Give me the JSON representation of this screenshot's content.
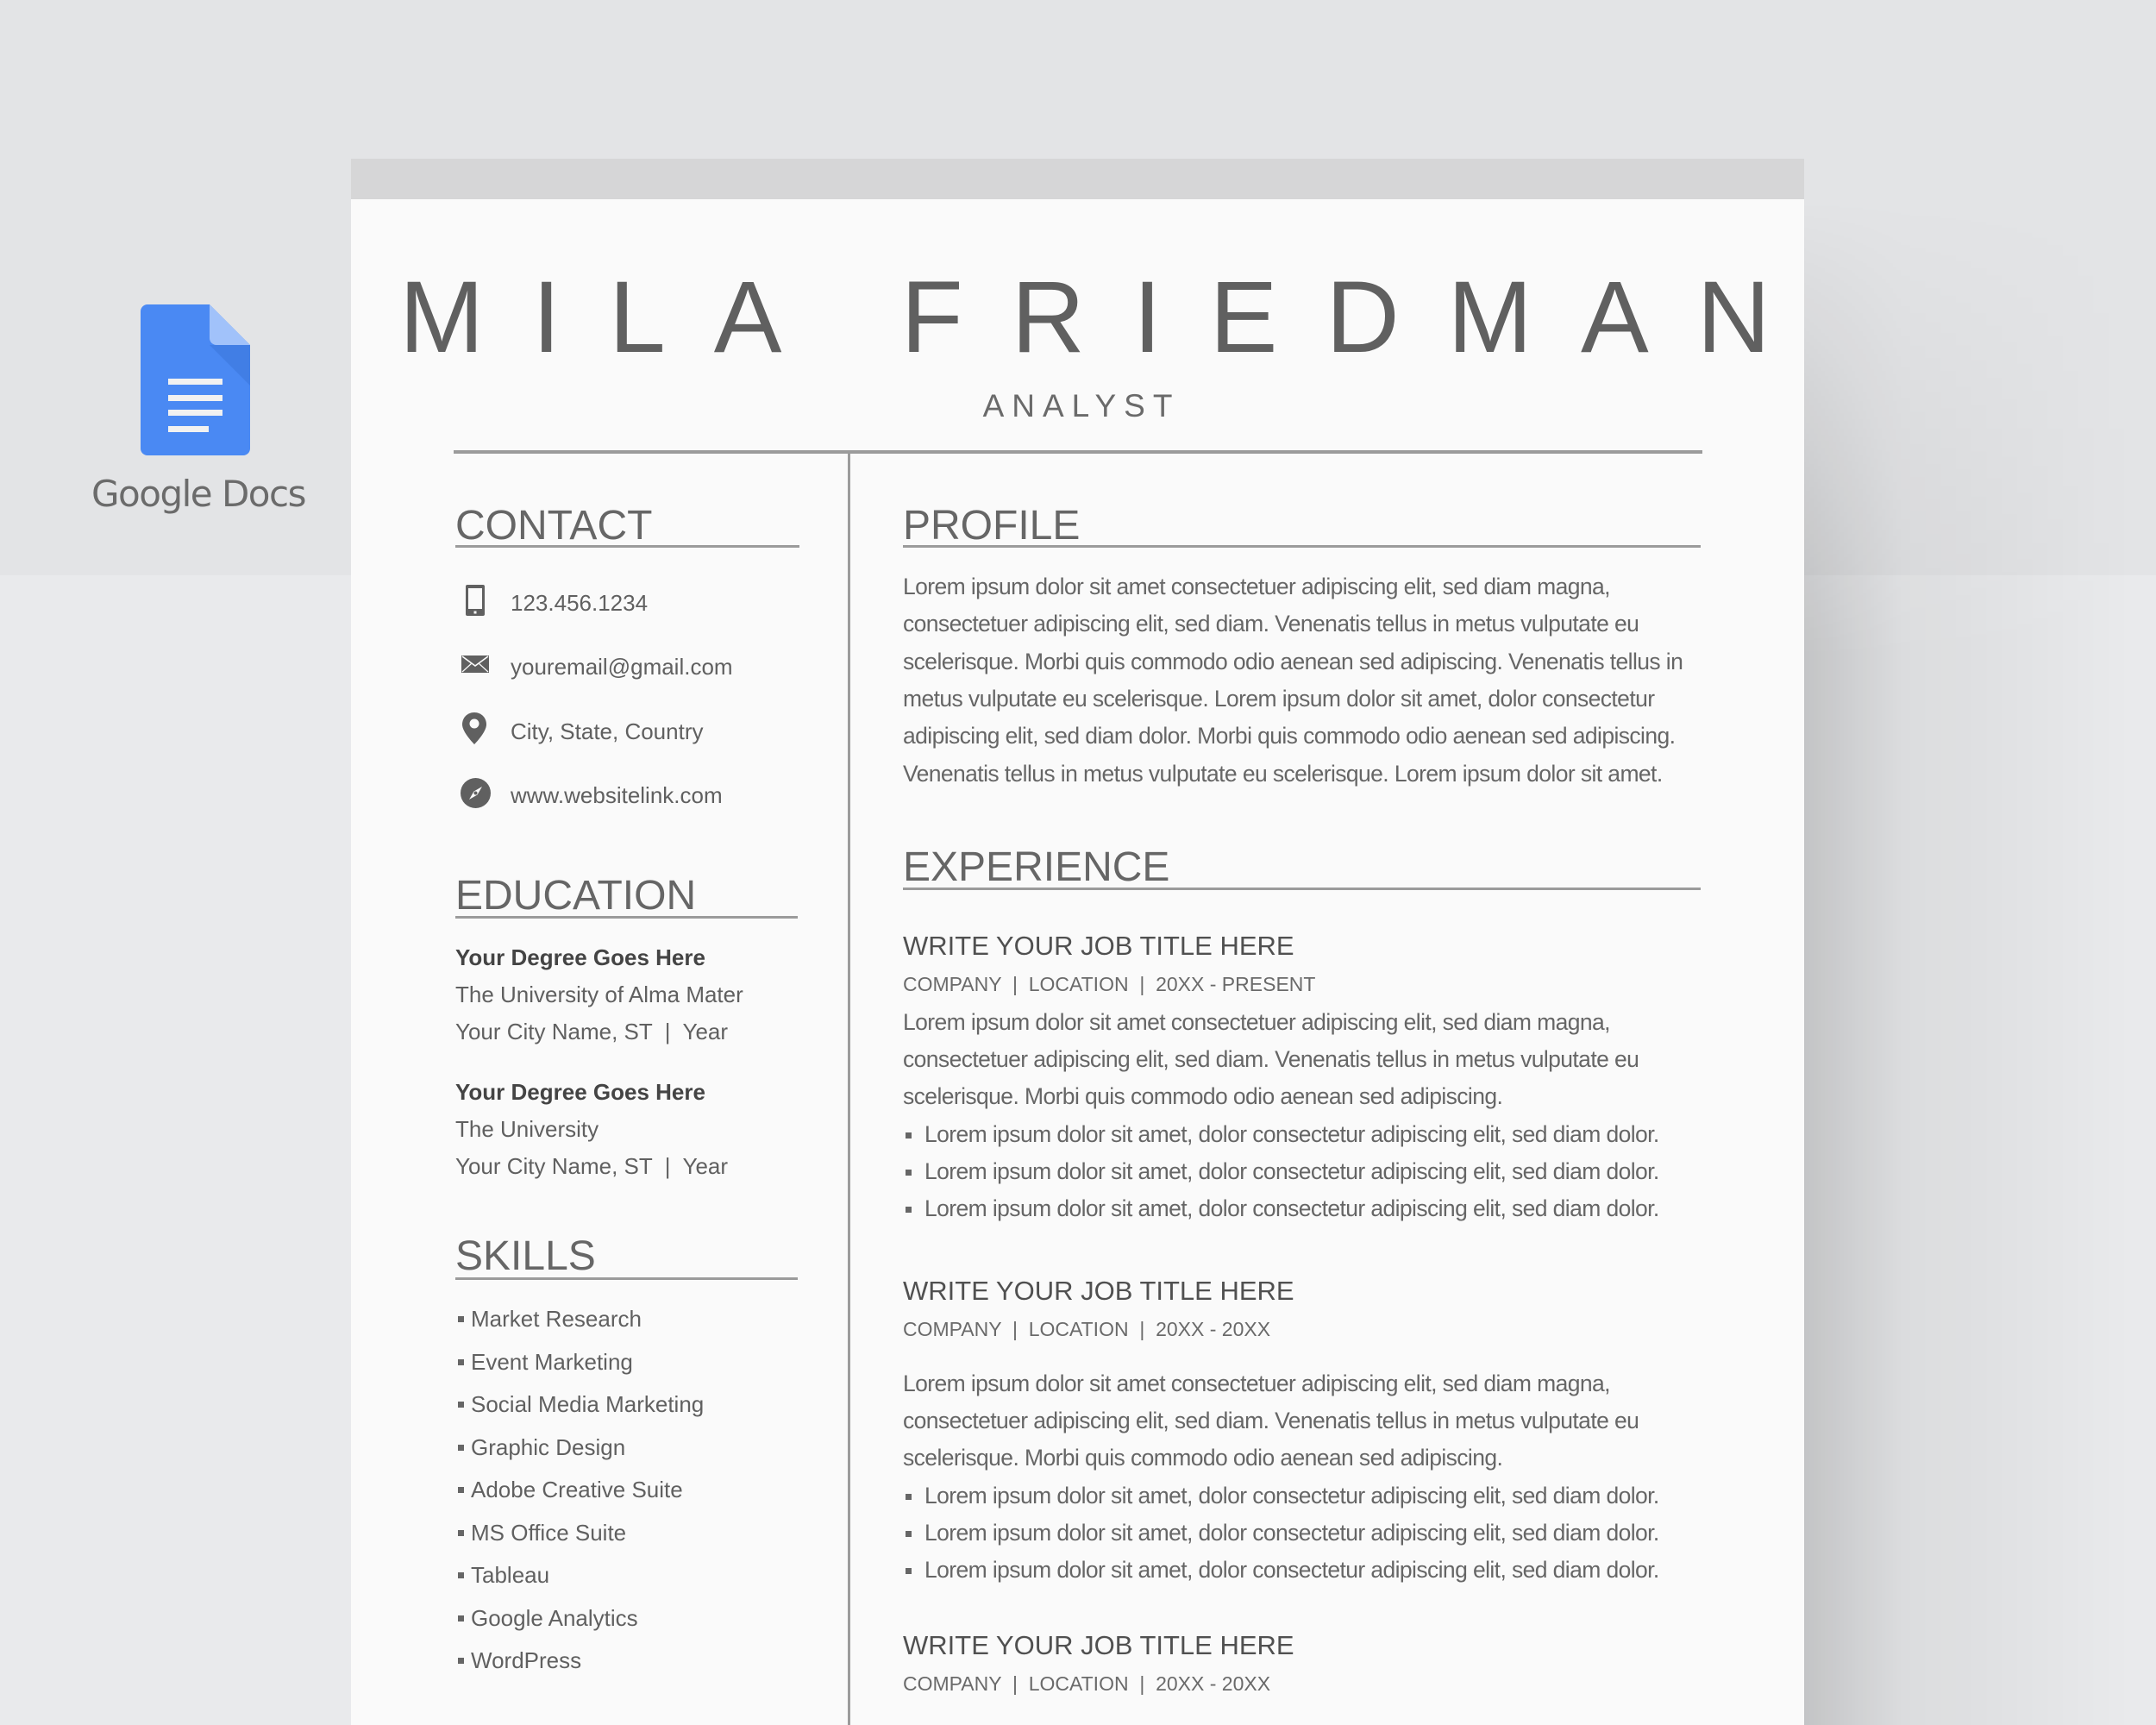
{
  "badge": {
    "icon": "google-docs-icon",
    "label": "Google Docs",
    "colors": {
      "icon_blue": "#4285f4",
      "fold_light": "#a1c2fa",
      "label_gray": "#6b6b6b"
    }
  },
  "resume": {
    "name": "MILA FRIEDMAN",
    "role": "ANALYST",
    "contact": {
      "title": "CONTACT",
      "items": [
        {
          "icon": "phone-icon",
          "text": "123.456.1234"
        },
        {
          "icon": "envelope-icon",
          "text": "youremail@gmail.com"
        },
        {
          "icon": "map-pin-icon",
          "text": "City, State, Country"
        },
        {
          "icon": "compass-icon",
          "text": "www.websitelink.com"
        }
      ]
    },
    "education": {
      "title": "EDUCATION",
      "entries": [
        {
          "degree": "Your Degree Goes Here",
          "school": "The University of Alma Mater",
          "location": "Your City Name, ST  |  Year"
        },
        {
          "degree": "Your Degree Goes Here",
          "school": "The University",
          "location": "Your City Name, ST  |  Year"
        }
      ]
    },
    "skills": {
      "title": "SKILLS",
      "items": [
        "Market Research",
        "Event Marketing",
        "Social Media Marketing",
        "Graphic Design",
        "Adobe Creative Suite",
        "MS Office Suite",
        "Tableau",
        "Google Analytics",
        "WordPress"
      ]
    },
    "profile": {
      "title": "PROFILE",
      "lines": [
        "Lorem ipsum dolor sit amet consectetuer adipiscing elit, sed diam magna,",
        "consectetuer adipiscing elit, sed diam. Venenatis tellus in metus vulputate eu",
        "scelerisque. Morbi quis commodo odio aenean sed adipiscing. Venenatis tellus in",
        "metus vulputate eu scelerisque. Lorem ipsum dolor sit amet, dolor consectetur",
        "adipiscing elit, sed diam dolor. Morbi quis commodo odio aenean sed adipiscing.",
        "Venenatis tellus in metus vulputate eu scelerisque. Lorem ipsum dolor sit amet."
      ]
    },
    "experience": {
      "title": "EXPERIENCE",
      "jobs": [
        {
          "title": "WRITE YOUR JOB TITLE HERE",
          "meta": "COMPANY  |  LOCATION  |  20XX - PRESENT",
          "lines": [
            "Lorem ipsum dolor sit amet consectetuer adipiscing elit, sed diam magna,",
            "consectetuer adipiscing elit, sed diam. Venenatis tellus in metus vulputate eu",
            "scelerisque. Morbi quis commodo odio aenean sed adipiscing."
          ],
          "bullets": [
            "Lorem ipsum dolor sit amet, dolor consectetur adipiscing elit, sed diam dolor.",
            "Lorem ipsum dolor sit amet, dolor consectetur adipiscing elit, sed diam dolor.",
            "Lorem ipsum dolor sit amet, dolor consectetur adipiscing elit, sed diam dolor."
          ]
        },
        {
          "title": "WRITE YOUR JOB TITLE HERE",
          "meta": "COMPANY  |  LOCATION  |  20XX - 20XX",
          "lines": [
            "Lorem ipsum dolor sit amet consectetuer adipiscing elit, sed diam magna,",
            "consectetuer adipiscing elit, sed diam. Venenatis tellus in metus vulputate eu",
            "scelerisque. Morbi quis commodo odio aenean sed adipiscing."
          ],
          "bullets": [
            "Lorem ipsum dolor sit amet, dolor consectetur adipiscing elit, sed diam dolor.",
            "Lorem ipsum dolor sit amet, dolor consectetur adipiscing elit, sed diam dolor.",
            "Lorem ipsum dolor sit amet, dolor consectetur adipiscing elit, sed diam dolor."
          ]
        },
        {
          "title": "WRITE YOUR JOB TITLE HERE",
          "meta": "COMPANY  |  LOCATION  |  20XX - 20XX"
        }
      ]
    }
  }
}
